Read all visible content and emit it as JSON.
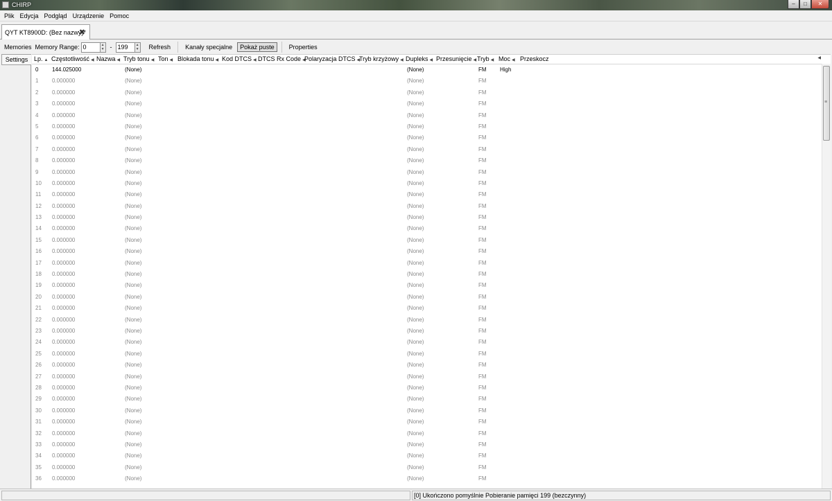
{
  "window": {
    "title": "CHIRP",
    "buttons": {
      "minimize": "–",
      "maximize": "□",
      "close": "✕"
    }
  },
  "menu": [
    "Plik",
    "Edycja",
    "Podgląd",
    "Urządzenie",
    "Pomoc"
  ],
  "file_tab": {
    "label": "QYT KT8900D: (Bez nazwy)*"
  },
  "toolbar": {
    "memories_label": "Memories",
    "memory_range_label": "Memory Range:",
    "range_start": "0",
    "range_dash": "-",
    "range_end": "199",
    "refresh_label": "Refresh",
    "special_channels_label": "Kanały specjalne",
    "show_empty_label": "Pokaż puste",
    "properties_label": "Properties"
  },
  "side_tab": {
    "settings_label": "Settings"
  },
  "columns": [
    {
      "key": "lp",
      "label": "Lp."
    },
    {
      "key": "freq",
      "label": "Częstotliwość"
    },
    {
      "key": "name",
      "label": "Nazwa"
    },
    {
      "key": "tone_mode",
      "label": "Tryb tonu"
    },
    {
      "key": "tone",
      "label": "Ton"
    },
    {
      "key": "tone_lock",
      "label": "Blokada tonu"
    },
    {
      "key": "dtcs_code",
      "label": "Kod DTCS"
    },
    {
      "key": "dtcs_rx",
      "label": "DTCS Rx Code"
    },
    {
      "key": "dtcs_pol",
      "label": "Polaryzacja DTCS"
    },
    {
      "key": "cross_mode",
      "label": "Tryb krzyżowy"
    },
    {
      "key": "duplex",
      "label": "Dupleks"
    },
    {
      "key": "offset",
      "label": "Przesunięcie"
    },
    {
      "key": "mode",
      "label": "Tryb"
    },
    {
      "key": "power",
      "label": "Moc"
    },
    {
      "key": "skip",
      "label": "Przeskocz"
    }
  ],
  "rows": [
    {
      "lp": "0",
      "freq": "144.025000",
      "tone_mode": "(None)",
      "duplex": "(None)",
      "mode": "FM",
      "power": "High",
      "filled": true
    },
    {
      "lp": "1",
      "freq": "0.000000",
      "tone_mode": "(None)",
      "duplex": "(None)",
      "mode": "FM",
      "power": ""
    },
    {
      "lp": "2",
      "freq": "0.000000",
      "tone_mode": "(None)",
      "duplex": "(None)",
      "mode": "FM",
      "power": ""
    },
    {
      "lp": "3",
      "freq": "0.000000",
      "tone_mode": "(None)",
      "duplex": "(None)",
      "mode": "FM",
      "power": ""
    },
    {
      "lp": "4",
      "freq": "0.000000",
      "tone_mode": "(None)",
      "duplex": "(None)",
      "mode": "FM",
      "power": ""
    },
    {
      "lp": "5",
      "freq": "0.000000",
      "tone_mode": "(None)",
      "duplex": "(None)",
      "mode": "FM",
      "power": ""
    },
    {
      "lp": "6",
      "freq": "0.000000",
      "tone_mode": "(None)",
      "duplex": "(None)",
      "mode": "FM",
      "power": ""
    },
    {
      "lp": "7",
      "freq": "0.000000",
      "tone_mode": "(None)",
      "duplex": "(None)",
      "mode": "FM",
      "power": ""
    },
    {
      "lp": "8",
      "freq": "0.000000",
      "tone_mode": "(None)",
      "duplex": "(None)",
      "mode": "FM",
      "power": ""
    },
    {
      "lp": "9",
      "freq": "0.000000",
      "tone_mode": "(None)",
      "duplex": "(None)",
      "mode": "FM",
      "power": ""
    },
    {
      "lp": "10",
      "freq": "0.000000",
      "tone_mode": "(None)",
      "duplex": "(None)",
      "mode": "FM",
      "power": ""
    },
    {
      "lp": "11",
      "freq": "0.000000",
      "tone_mode": "(None)",
      "duplex": "(None)",
      "mode": "FM",
      "power": ""
    },
    {
      "lp": "12",
      "freq": "0.000000",
      "tone_mode": "(None)",
      "duplex": "(None)",
      "mode": "FM",
      "power": ""
    },
    {
      "lp": "13",
      "freq": "0.000000",
      "tone_mode": "(None)",
      "duplex": "(None)",
      "mode": "FM",
      "power": ""
    },
    {
      "lp": "14",
      "freq": "0.000000",
      "tone_mode": "(None)",
      "duplex": "(None)",
      "mode": "FM",
      "power": ""
    },
    {
      "lp": "15",
      "freq": "0.000000",
      "tone_mode": "(None)",
      "duplex": "(None)",
      "mode": "FM",
      "power": ""
    },
    {
      "lp": "16",
      "freq": "0.000000",
      "tone_mode": "(None)",
      "duplex": "(None)",
      "mode": "FM",
      "power": ""
    },
    {
      "lp": "17",
      "freq": "0.000000",
      "tone_mode": "(None)",
      "duplex": "(None)",
      "mode": "FM",
      "power": ""
    },
    {
      "lp": "18",
      "freq": "0.000000",
      "tone_mode": "(None)",
      "duplex": "(None)",
      "mode": "FM",
      "power": ""
    },
    {
      "lp": "19",
      "freq": "0.000000",
      "tone_mode": "(None)",
      "duplex": "(None)",
      "mode": "FM",
      "power": ""
    },
    {
      "lp": "20",
      "freq": "0.000000",
      "tone_mode": "(None)",
      "duplex": "(None)",
      "mode": "FM",
      "power": ""
    },
    {
      "lp": "21",
      "freq": "0.000000",
      "tone_mode": "(None)",
      "duplex": "(None)",
      "mode": "FM",
      "power": ""
    },
    {
      "lp": "22",
      "freq": "0.000000",
      "tone_mode": "(None)",
      "duplex": "(None)",
      "mode": "FM",
      "power": ""
    },
    {
      "lp": "23",
      "freq": "0.000000",
      "tone_mode": "(None)",
      "duplex": "(None)",
      "mode": "FM",
      "power": ""
    },
    {
      "lp": "24",
      "freq": "0.000000",
      "tone_mode": "(None)",
      "duplex": "(None)",
      "mode": "FM",
      "power": ""
    },
    {
      "lp": "25",
      "freq": "0.000000",
      "tone_mode": "(None)",
      "duplex": "(None)",
      "mode": "FM",
      "power": ""
    },
    {
      "lp": "26",
      "freq": "0.000000",
      "tone_mode": "(None)",
      "duplex": "(None)",
      "mode": "FM",
      "power": ""
    },
    {
      "lp": "27",
      "freq": "0.000000",
      "tone_mode": "(None)",
      "duplex": "(None)",
      "mode": "FM",
      "power": ""
    },
    {
      "lp": "28",
      "freq": "0.000000",
      "tone_mode": "(None)",
      "duplex": "(None)",
      "mode": "FM",
      "power": ""
    },
    {
      "lp": "29",
      "freq": "0.000000",
      "tone_mode": "(None)",
      "duplex": "(None)",
      "mode": "FM",
      "power": ""
    },
    {
      "lp": "30",
      "freq": "0.000000",
      "tone_mode": "(None)",
      "duplex": "(None)",
      "mode": "FM",
      "power": ""
    },
    {
      "lp": "31",
      "freq": "0.000000",
      "tone_mode": "(None)",
      "duplex": "(None)",
      "mode": "FM",
      "power": ""
    },
    {
      "lp": "32",
      "freq": "0.000000",
      "tone_mode": "(None)",
      "duplex": "(None)",
      "mode": "FM",
      "power": ""
    },
    {
      "lp": "33",
      "freq": "0.000000",
      "tone_mode": "(None)",
      "duplex": "(None)",
      "mode": "FM",
      "power": ""
    },
    {
      "lp": "34",
      "freq": "0.000000",
      "tone_mode": "(None)",
      "duplex": "(None)",
      "mode": "FM",
      "power": ""
    },
    {
      "lp": "35",
      "freq": "0.000000",
      "tone_mode": "(None)",
      "duplex": "(None)",
      "mode": "FM",
      "power": ""
    },
    {
      "lp": "36",
      "freq": "0.000000",
      "tone_mode": "(None)",
      "duplex": "(None)",
      "mode": "FM",
      "power": ""
    }
  ],
  "status": {
    "left": "",
    "right": "[0] Ukończono pomyślnie Pobieranie pamięci 199 (bezczynny)"
  }
}
